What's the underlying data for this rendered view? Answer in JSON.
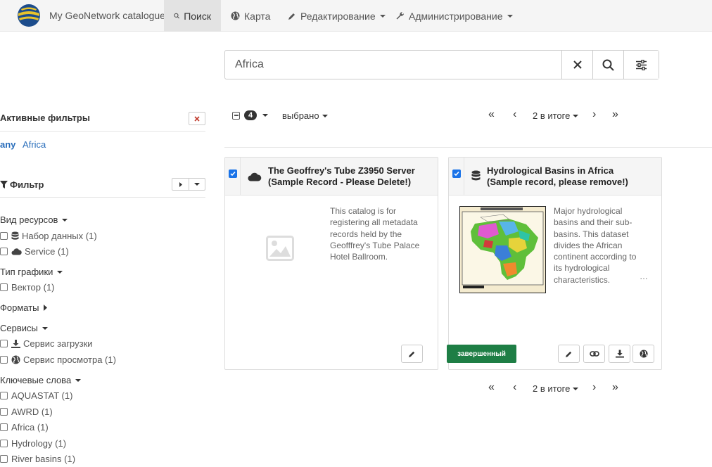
{
  "navbar": {
    "brand": "My GeoNetwork catalogue",
    "items": [
      {
        "label": "Поиск",
        "icon": "search-icon"
      },
      {
        "label": "Карта",
        "icon": "globe-icon"
      },
      {
        "label": "Редактирование",
        "icon": "pencil-icon"
      },
      {
        "label": "Администрирование",
        "icon": "wrench-icon"
      }
    ]
  },
  "search": {
    "value": "Africa",
    "placeholder": ""
  },
  "filters": {
    "active_title": "Активные фильтры",
    "active_prefix": "any",
    "active_value": "Africa",
    "filter_title": "Фильтр",
    "facets": [
      {
        "title": "Вид ресурсов",
        "items": [
          "Набор данных (1)",
          "Service (1)"
        ]
      },
      {
        "title": "Тип графики",
        "items": [
          "Вектор (1)"
        ]
      },
      {
        "title": "Форматы",
        "items": []
      },
      {
        "title": "Сервисы",
        "items": [
          "Сервис загрузки",
          "Сервис просмотра (1)"
        ]
      },
      {
        "title": "Ключевые слова",
        "items": [
          "AQUASTAT (1)",
          "AWRD (1)",
          "Africa (1)",
          "Hydrology (1)",
          "River basins (1)"
        ]
      }
    ]
  },
  "results": {
    "selected_count": "4",
    "selected_label": "выбрано",
    "pager_label": "2 в итоге",
    "cards": [
      {
        "title": "The Geoffrey's Tube Z3950 Server (Sample Record - Please Delete!)",
        "abstract": "This catalog is for registering all metadata records held by the Geofffrey's Tube Palace Hotel Ballroom.",
        "type_icon": "cloud-icon"
      },
      {
        "title": "Hydrological Basins in Africa (Sample record, please remove!)",
        "abstract": "Major hydrological basins and their sub-basins. This dataset divides the African continent according to its hydrological characteristics.",
        "ellipsis": "…",
        "type_icon": "database-icon",
        "status": "завершенный"
      }
    ]
  }
}
